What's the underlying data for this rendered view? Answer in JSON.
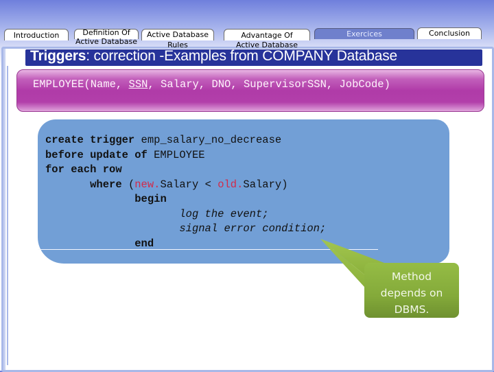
{
  "tabs": [
    {
      "label_line1": "Introduction",
      "label_line2": "",
      "active": false
    },
    {
      "label_line1": "Definition Of",
      "label_line2": "Active Database",
      "active": false
    },
    {
      "label_line1": "Active Database",
      "label_line2": "Rules",
      "active": false
    },
    {
      "label_line1": "Advantage Of",
      "label_line2": "Active Database",
      "active": false
    },
    {
      "label_line1": "Exercices",
      "label_line2": "",
      "active": true
    },
    {
      "label_line1": "Conclusion",
      "label_line2": "",
      "active": false
    }
  ],
  "title": {
    "bold": "Triggers",
    "rest": ": correction -Examples from COMPANY Database"
  },
  "schema": {
    "prefix": "EMPLOYEE(Name, ",
    "key": "SSN",
    "suffix": ", Salary, DNO, SupervisorSSN, JobCode)"
  },
  "code": {
    "line1_kw": "create trigger",
    "line1_rest": " emp_salary_no_decrease",
    "line2_kw": "before update of",
    "line2_rest": " EMPLOYEE",
    "line3_kw": "for each row",
    "line4_indent": "       ",
    "line4_kw": "where",
    "line4_open": " (",
    "line4_new": "new.",
    "line4_mid": "Salary < ",
    "line4_old": "old.",
    "line4_end": "Salary)",
    "line5_indent": "              ",
    "line5_kw": "begin",
    "line6_indent": "                     ",
    "line6_it": "log the event;",
    "line7_indent": "                     ",
    "line7_it": "signal error condition;",
    "line8_indent": "              ",
    "line8_kw": "end"
  },
  "callout": {
    "line1": "Method",
    "line2": "depends on",
    "line3": "DBMS."
  },
  "colors": {
    "title_bar": "#27339a",
    "schema_box": "#b03ba8",
    "code_box": "#729fd6",
    "callout": "#84aa3a",
    "keyword_red": "#d22a4a",
    "active_tab": "#6f80cc"
  }
}
